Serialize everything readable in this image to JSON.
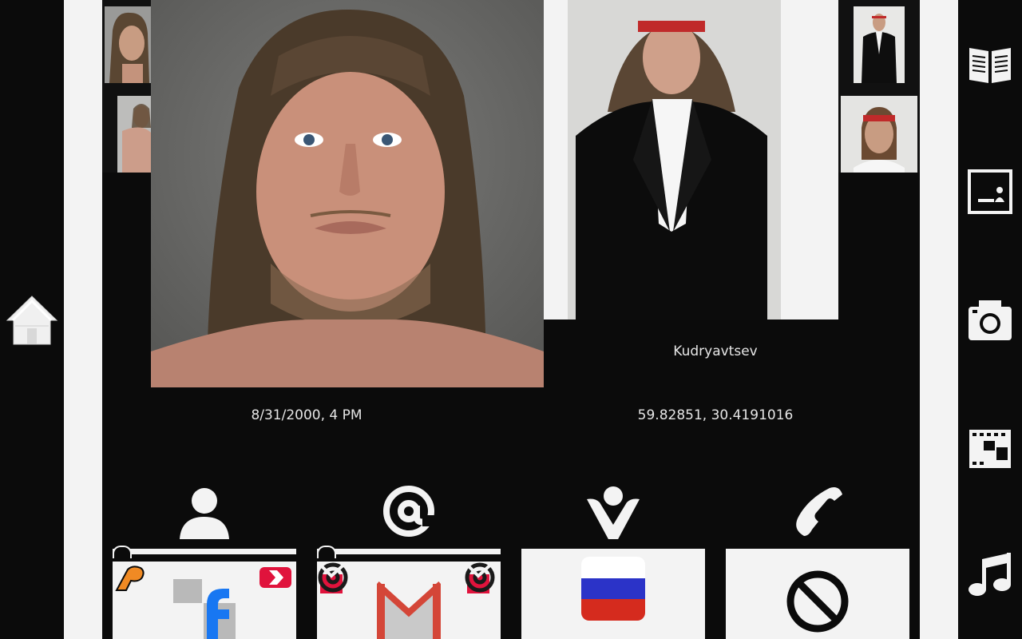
{
  "profile": {
    "surname": "Kudryavtsev",
    "datetime": "8/31/2000, 4 PM",
    "coordinates": "59.82851, 30.4191016"
  },
  "nav_icons": {
    "left": [
      "home-icon"
    ],
    "right": [
      "book-icon",
      "id-card-icon",
      "camera-icon",
      "film-icon",
      "music-icon"
    ]
  },
  "contact_icons": [
    "person-icon",
    "at-icon",
    "vk-icon",
    "phone-icon"
  ],
  "cards": {
    "social": {
      "icons": [
        "adpoint-icon",
        "arrow-badge-icon",
        "facebook-icon"
      ]
    },
    "email": {
      "icons": [
        "mail-check-icon",
        "mail-check-icon",
        "gmail-icon"
      ]
    },
    "country": {
      "icons": [
        "russia-flag-icon"
      ]
    },
    "phone": {
      "icons": [
        "no-entry-icon"
      ]
    }
  },
  "colors": {
    "background": "#0b0b0b",
    "panel": "#f3f3f3",
    "text": "#e6e6e6",
    "facebook_blue": "#1877f2",
    "gmail_red": "#d44638",
    "badge_red": "#e0133c",
    "flag_white": "#ffffff",
    "flag_blue": "#2b33c8",
    "flag_red": "#d52b1e"
  }
}
